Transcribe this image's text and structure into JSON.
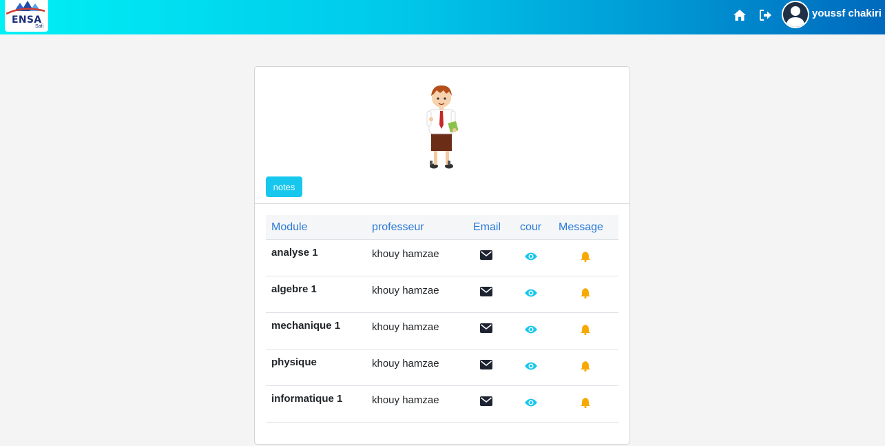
{
  "header": {
    "logo_text": "ENSA",
    "logo_sub": "Safi",
    "user_name": "youssf chakiri"
  },
  "card": {
    "notes_button": "notes",
    "columns": [
      "Module",
      "professeur",
      "Email",
      "cour",
      "Message"
    ],
    "rows": [
      {
        "module": "analyse 1",
        "professor": "khouy hamzae"
      },
      {
        "module": "algebre 1",
        "professor": "khouy hamzae"
      },
      {
        "module": "mechanique 1",
        "professor": "khouy hamzae"
      },
      {
        "module": "physique",
        "professor": "khouy hamzae"
      },
      {
        "module": "informatique 1",
        "professor": "khouy hamzae"
      }
    ]
  },
  "icons": {
    "home": "home-icon",
    "logout": "logout-icon",
    "email": "envelope-icon",
    "cour": "eye-icon",
    "message": "bell-icon"
  },
  "colors": {
    "accent": "#17c7ed",
    "header_text": "#2a7ad6",
    "bell": "#f7a900",
    "eye": "#17c7ed"
  }
}
